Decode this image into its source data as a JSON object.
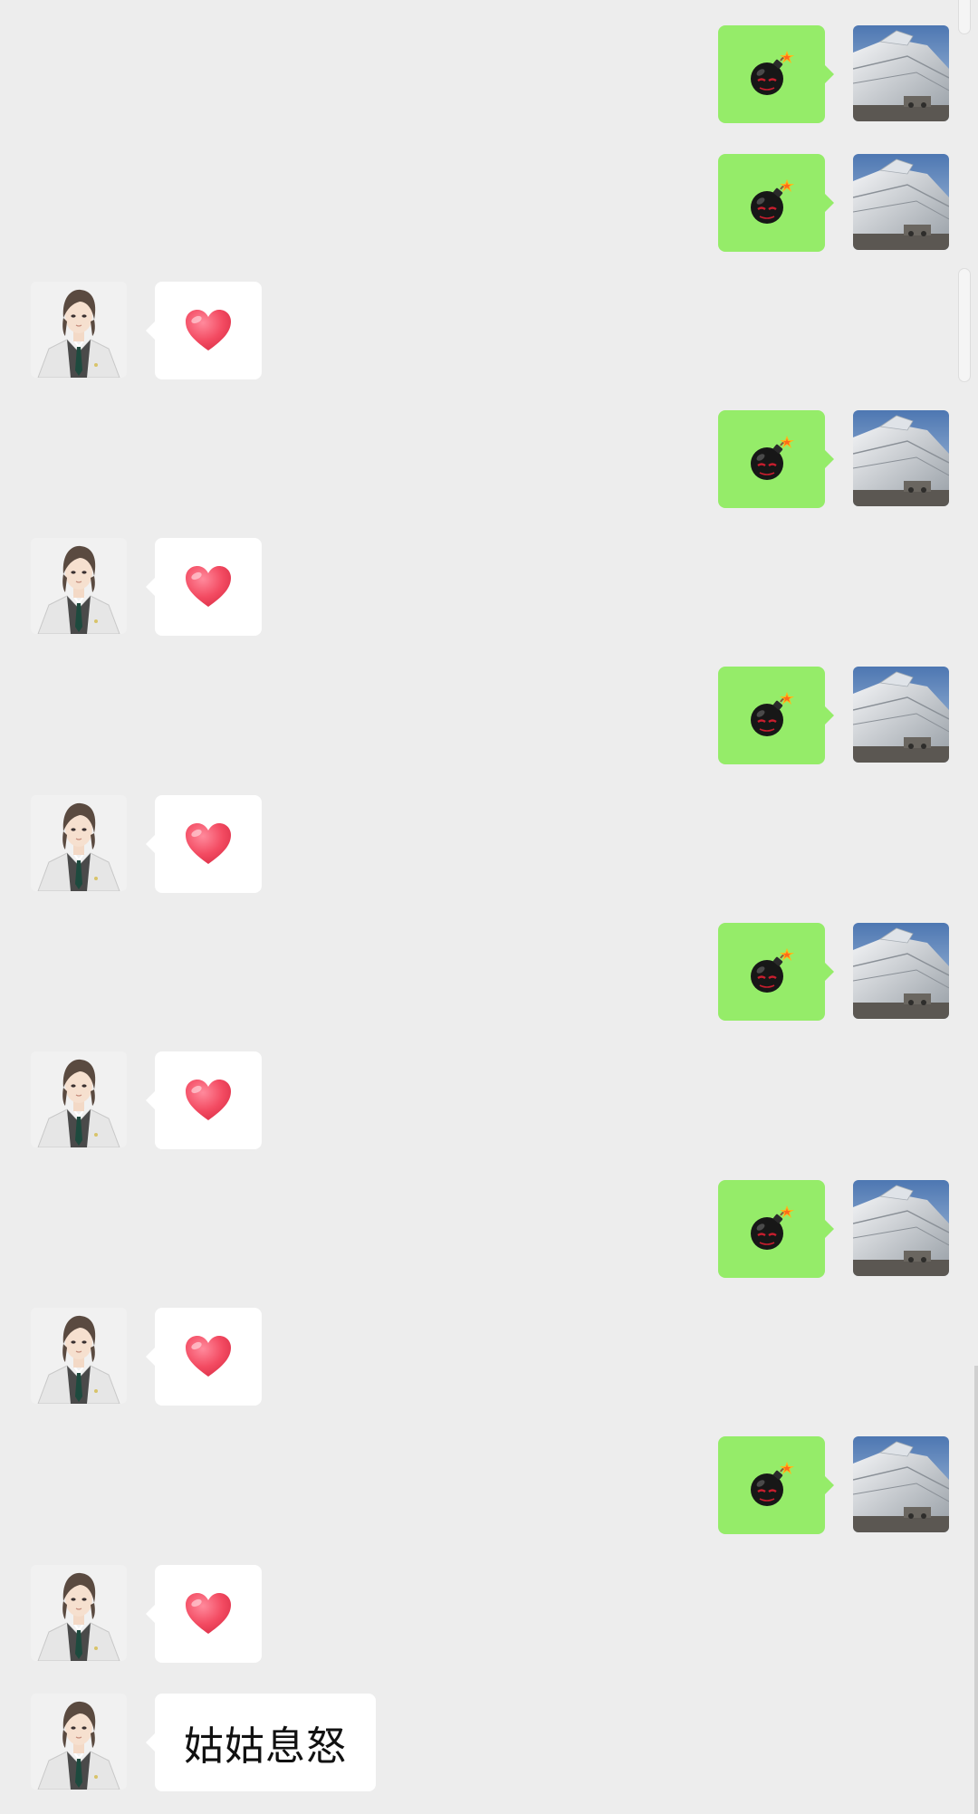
{
  "chat": {
    "colors": {
      "background": "#ededed",
      "outgoing_bubble": "#95ec69",
      "incoming_bubble": "#ffffff"
    },
    "messages": [
      {
        "side": "out",
        "kind": "emoji",
        "emoji": "bomb-emoji"
      },
      {
        "side": "out",
        "kind": "emoji",
        "emoji": "bomb-emoji"
      },
      {
        "side": "in",
        "kind": "emoji",
        "emoji": "heart-emoji"
      },
      {
        "side": "out",
        "kind": "emoji",
        "emoji": "bomb-emoji"
      },
      {
        "side": "in",
        "kind": "emoji",
        "emoji": "heart-emoji"
      },
      {
        "side": "out",
        "kind": "emoji",
        "emoji": "bomb-emoji"
      },
      {
        "side": "in",
        "kind": "emoji",
        "emoji": "heart-emoji"
      },
      {
        "side": "out",
        "kind": "emoji",
        "emoji": "bomb-emoji"
      },
      {
        "side": "in",
        "kind": "emoji",
        "emoji": "heart-emoji"
      },
      {
        "side": "out",
        "kind": "emoji",
        "emoji": "bomb-emoji"
      },
      {
        "side": "in",
        "kind": "emoji",
        "emoji": "heart-emoji"
      },
      {
        "side": "out",
        "kind": "emoji",
        "emoji": "bomb-emoji"
      },
      {
        "side": "in",
        "kind": "emoji",
        "emoji": "heart-emoji"
      },
      {
        "side": "in",
        "kind": "text",
        "text": "姑姑息怒"
      }
    ],
    "avatars": {
      "incoming": "man-in-white-coat-avatar",
      "outgoing": "ship-photo-avatar"
    }
  }
}
